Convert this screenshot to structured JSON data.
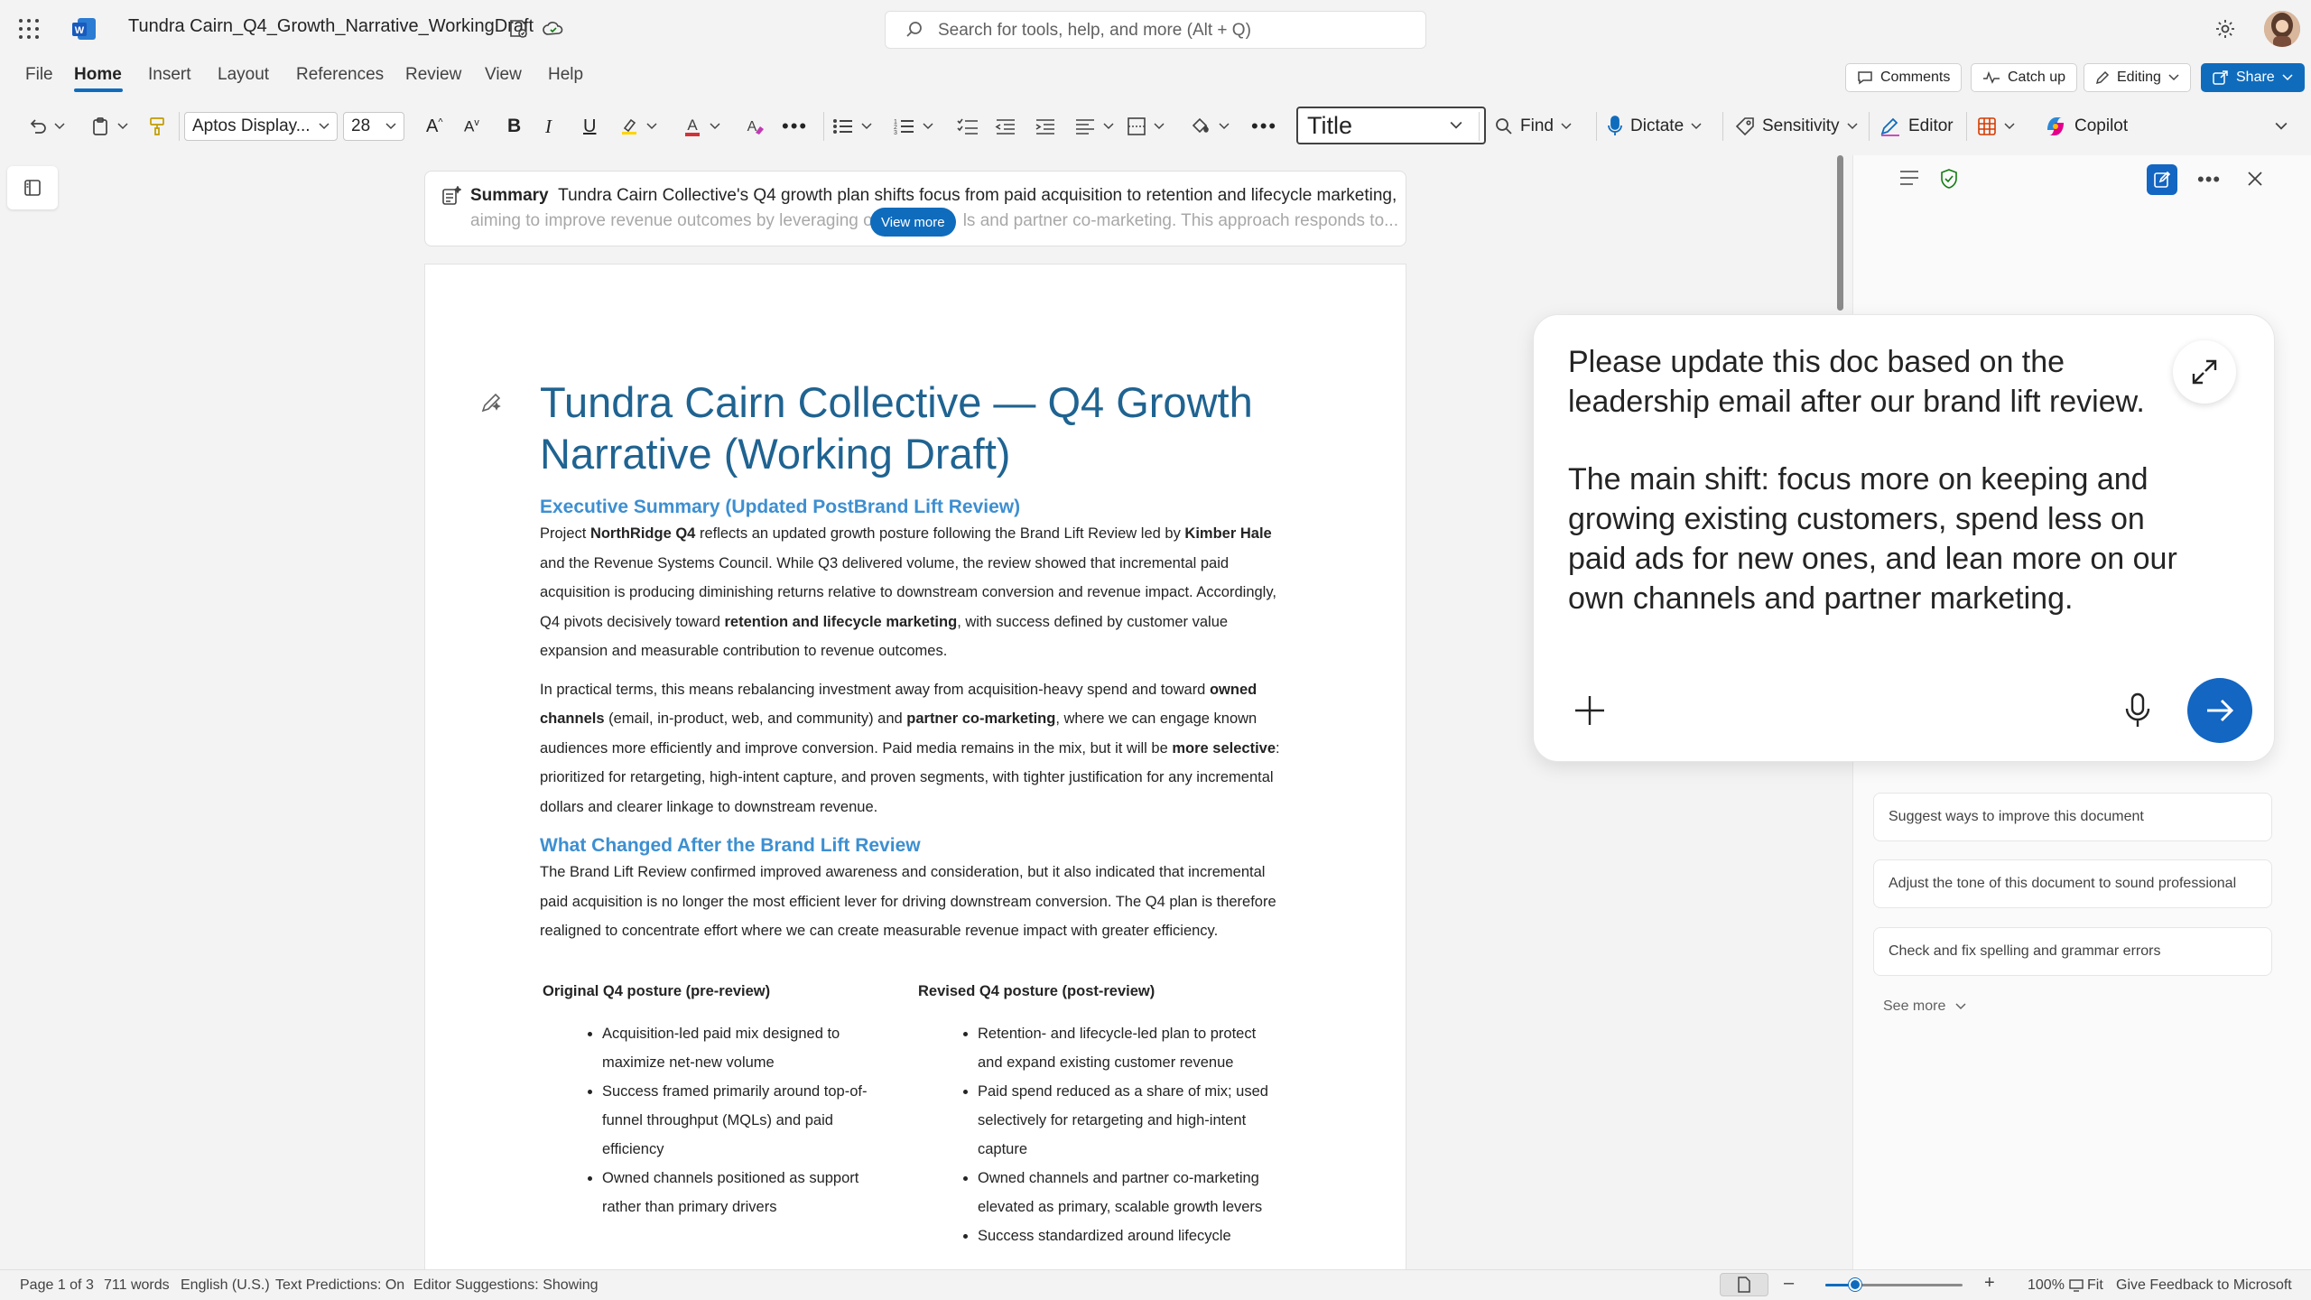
{
  "titlebar": {
    "doc_name": "Tundra Cairn_Q4_Growth_Narrative_WorkingDraft",
    "search_placeholder": "Search for tools, help, and more (Alt + Q)"
  },
  "menu": {
    "tabs": [
      "File",
      "Home",
      "Insert",
      "Layout",
      "References",
      "Review",
      "View",
      "Help"
    ],
    "active_tab": "Home",
    "comments_label": "Comments",
    "catchup_label": "Catch up",
    "editing_label": "Editing",
    "share_label": "Share"
  },
  "ribbon": {
    "font_name": "Aptos Display...",
    "font_size": "28",
    "style_name": "Title",
    "find_label": "Find",
    "dictate_label": "Dictate",
    "sensitivity_label": "Sensitivity",
    "editor_label": "Editor",
    "copilot_label": "Copilot",
    "accent_color": "#d13438"
  },
  "summary": {
    "label": "Summary",
    "line1": "Tundra Cairn Collective's Q4 growth plan shifts focus from paid acquisition to retention and lifecycle marketing,",
    "line2_left": "aiming to improve revenue outcomes by leveraging o",
    "line2_right": "ls and partner co-marketing. This approach responds to...",
    "view_more_label": "View more"
  },
  "document": {
    "title": "Tundra Cairn Collective — Q4 Growth Narrative (Working Draft)",
    "h_exec": "Executive Summary (Updated PostBrand Lift Review)",
    "p1": [
      {
        "t": "Project "
      },
      {
        "t": "NorthRidge Q4",
        "b": true
      },
      {
        "t": " reflects an updated growth posture following the Brand Lift Review led by "
      },
      {
        "t": "Kimber Hale",
        "b": true
      },
      {
        "t": " and the Revenue Systems Council. While Q3 delivered volume, the review showed that incremental paid acquisition is producing diminishing returns relative to downstream conversion and revenue impact. Accordingly, Q4 pivots decisively toward "
      },
      {
        "t": "retention and lifecycle marketing",
        "b": true
      },
      {
        "t": ", with success defined by customer value expansion and measurable contribution to revenue outcomes."
      }
    ],
    "p2": [
      {
        "t": "In practical terms, this means rebalancing investment away from acquisition-heavy spend and toward "
      },
      {
        "t": "owned channels",
        "b": true
      },
      {
        "t": " (email, in-product, web, and community) and "
      },
      {
        "t": "partner co-marketing",
        "b": true
      },
      {
        "t": ", where we can engage known audiences more efficiently and improve conversion. Paid media remains in the mix, but it will be "
      },
      {
        "t": "more selective",
        "b": true
      },
      {
        "t": ": prioritized for retargeting, high-intent capture, and proven segments, with tighter justification for any incremental dollars and clearer linkage to downstream revenue."
      }
    ],
    "h_changed": "What Changed After the Brand Lift Review",
    "p3": "The Brand Lift Review confirmed improved awareness and consideration, but it also indicated that incremental paid acquisition is no longer the most efficient lever for driving downstream conversion. The Q4 plan is therefore realigned to concentrate effort where we can create measurable revenue impact with greater efficiency.",
    "col_left_head": "Original Q4 posture (pre-review)",
    "col_left_items": [
      "Acquisition-led paid mix designed to maximize net-new volume",
      "Success framed primarily around top-of-funnel throughput (MQLs) and paid efficiency",
      "Owned channels positioned as support rather than primary drivers"
    ],
    "col_right_head": "Revised Q4 posture (post-review)",
    "col_right_items": [
      "Retention- and lifecycle-led plan to protect and expand existing customer revenue",
      "Paid spend reduced as a share of mix; used selectively for retargeting and high-intent capture",
      "Owned channels and partner co-marketing elevated as primary, scalable growth levers",
      "Success standardized around lifecycle"
    ]
  },
  "copilot": {
    "prompt_p1": "Please update this doc based on the leadership email after our brand lift review.",
    "prompt_p2": "The main shift: focus more on keeping and growing existing customers, spend less on paid ads for new ones, and lean more on our own channels and partner marketing.",
    "suggestions": [
      "Suggest ways to improve this document",
      "Adjust the tone of this document to sound professional",
      "Check and fix spelling and grammar errors"
    ],
    "see_more_label": "See more"
  },
  "statusbar": {
    "page": "Page 1 of 3",
    "words": "711 words",
    "language": "English (U.S.)",
    "predictions": "Text Predictions: On",
    "editor_suggestions": "Editor Suggestions: Showing",
    "zoom": "100%",
    "fit_label": "Fit",
    "feedback_label": "Give Feedback to Microsoft",
    "zoom_level": 0.22
  }
}
